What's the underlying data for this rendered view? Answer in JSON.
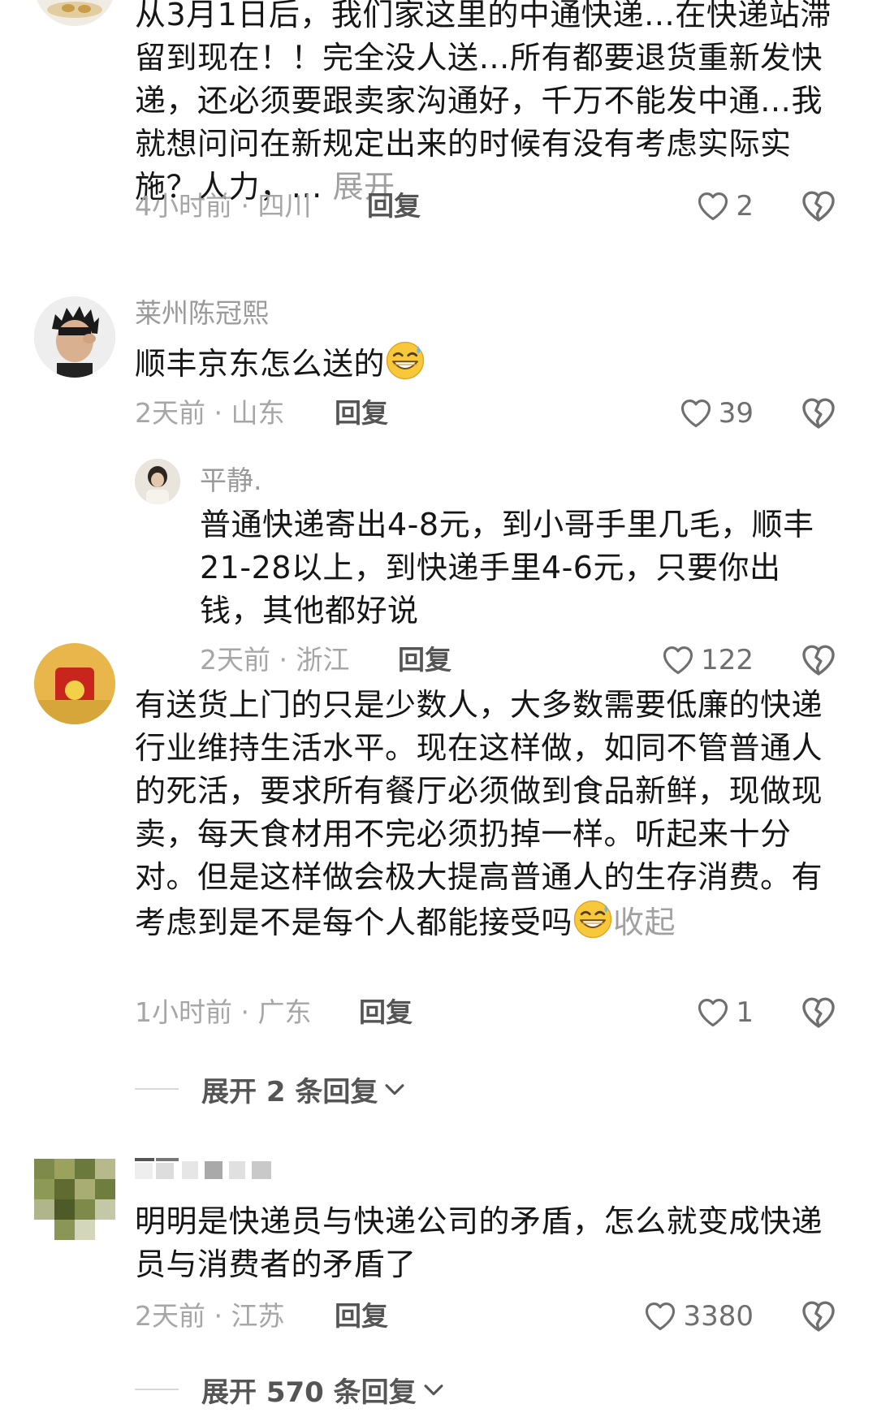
{
  "comments": [
    {
      "text": "从3月1日后，我们家这里的中通快递…在快递站滞留到现在！！完全没人送…所有都要退货重新发快递，还必须要跟卖家沟通好，千万不能发中通…我就想问问在新规定出来的时候有没有考虑实际实施？人力，…",
      "expand_label": "展开",
      "meta": "4小时前 · 四川",
      "reply_label": "回复",
      "likes": "2"
    },
    {
      "username": "莱州陈冠熙",
      "text": "顺丰京东怎么送的",
      "emoji": "grinning-sweat-emoji",
      "meta": "2天前 · 山东",
      "reply_label": "回复",
      "likes": "39",
      "reply": {
        "username": "平静.",
        "text": "普通快递寄出4-8元，到小哥手里几毛，顺丰21-28以上，到快递手里4-6元，只要你出钱，其他都好说",
        "meta": "2天前 · 浙江",
        "reply_label": "回复",
        "likes": "122"
      }
    },
    {
      "text": "有送货上门的只是少数人，大多数需要低廉的快递行业维持生活水平。现在这样做，如同不管普通人的死活，要求所有餐厅必须做到食品新鲜，现做现卖，每天食材用不完必须扔掉一样。听起来十分对。但是这样做会极大提高普通人的生存消费。有考虑到是不是每个人都能接受吗",
      "emoji": "grinning-sweat-emoji",
      "collapse_label": "收起",
      "meta": "1小时前 · 广东",
      "reply_label": "回复",
      "likes": "1",
      "expand_replies": "展开 2 条回复"
    },
    {
      "text": "明明是快递员与快递公司的矛盾，怎么就变成快递员与消费者的矛盾了",
      "meta": "2天前 · 江苏",
      "reply_label": "回复",
      "likes": "3380",
      "expand_replies": "展开 570 条回复"
    }
  ],
  "colors": {
    "text": "#161616",
    "meta": "#a6a6a6",
    "username": "#9a9a9a",
    "action": "#555555",
    "icon": "#6f6f6f"
  },
  "icons": [
    "heart-outline-icon",
    "broken-heart-icon",
    "chevron-down-icon"
  ]
}
